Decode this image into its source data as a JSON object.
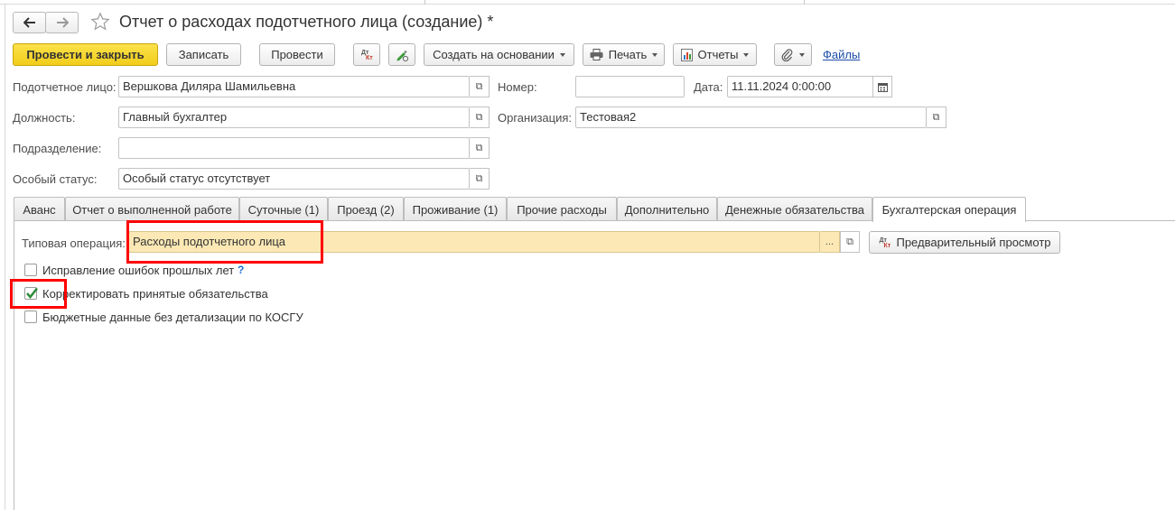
{
  "window": {
    "title": "Отчет о расходах подотчетного лица (создание) *"
  },
  "toolbar": {
    "post_close": "Провести и закрыть",
    "save": "Записать",
    "post": "Провести",
    "create_based": "Создать на основании",
    "print": "Печать",
    "reports": "Отчеты",
    "files": "Файлы"
  },
  "form": {
    "person_label": "Подотчетное лицо:",
    "person_value": "Вершкова Диляра Шамильевна",
    "position_label": "Должность:",
    "position_value": "Главный бухгалтер",
    "department_label": "Подразделение:",
    "department_value": "",
    "status_label": "Особый статус:",
    "status_value": "Особый статус отсутствует",
    "number_label": "Номер:",
    "number_value": "",
    "date_label": "Дата:",
    "date_value": "11.11.2024  0:00:00",
    "org_label": "Организация:",
    "org_value": "Тестовая2"
  },
  "tabs": [
    {
      "label": "Аванс"
    },
    {
      "label": "Отчет о выполненной работе"
    },
    {
      "label": "Суточные (1)"
    },
    {
      "label": "Проезд (2)"
    },
    {
      "label": "Проживание (1)"
    },
    {
      "label": "Прочие расходы"
    },
    {
      "label": "Дополнительно"
    },
    {
      "label": "Денежные обязательства"
    },
    {
      "label": "Бухгалтерская операция"
    }
  ],
  "operation": {
    "label": "Типовая операция:",
    "value": "Расходы подотчетного лица",
    "select_glyph": "...",
    "preview": "Предварительный просмотр"
  },
  "checkboxes": [
    {
      "label": "Исправление ошибок прошлых лет",
      "checked": false,
      "help": "?"
    },
    {
      "label": "Корректировать принятые обязательства",
      "checked": true
    },
    {
      "label": "Бюджетные данные без детализации по КОСГУ",
      "checked": false
    }
  ],
  "icons": {
    "dt": "Дт",
    "kt": "Кт"
  },
  "colors": {
    "primary_button": "#f5d322",
    "highlight_field": "#fbe8b4",
    "annotation": "#ff0000",
    "link": "#1c4da8",
    "check": "#2e8b3a"
  }
}
